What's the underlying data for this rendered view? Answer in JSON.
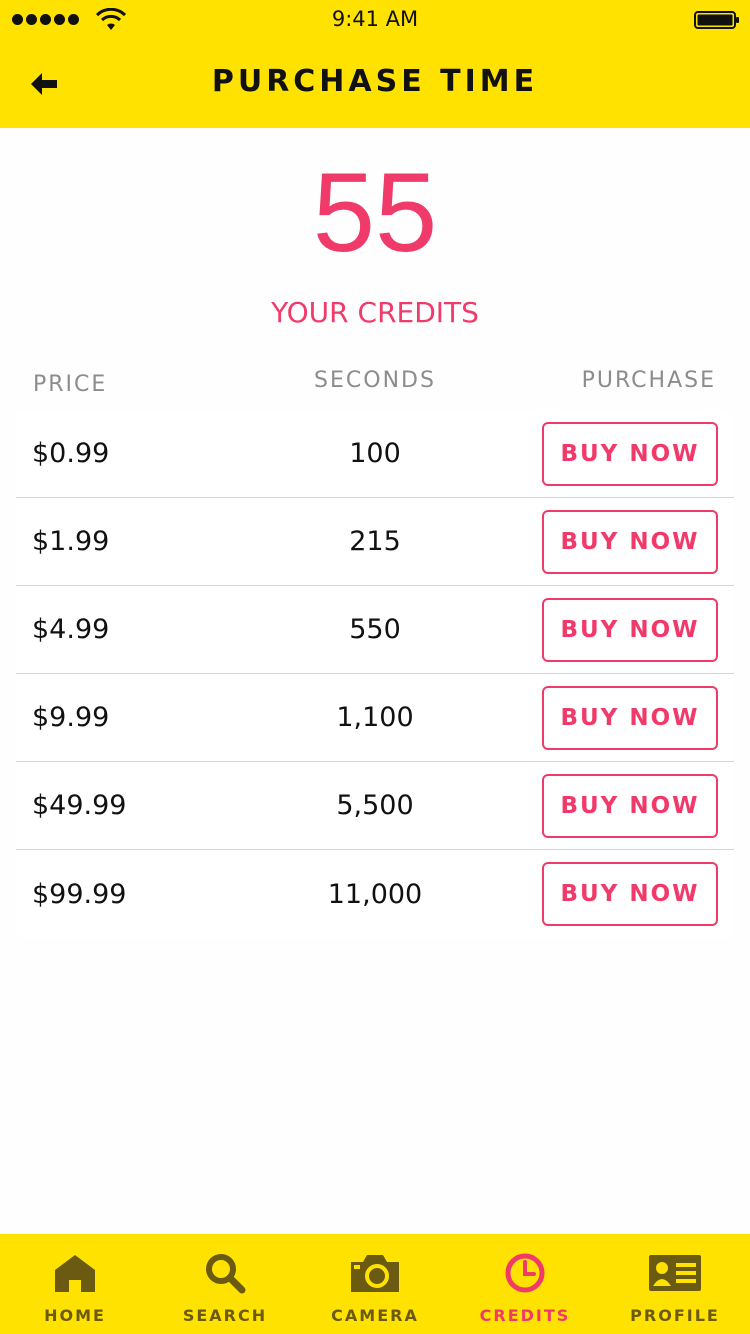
{
  "status_bar": {
    "time": "9:41 AM",
    "signal_icon": "signal-dots-icon",
    "wifi_icon": "wifi-icon",
    "battery_icon": "battery-icon"
  },
  "header": {
    "title": "PURCHASE TIME",
    "back_icon": "arrow-left-icon"
  },
  "credits": {
    "value": "55",
    "label": "YOUR CREDITS"
  },
  "table": {
    "columns": {
      "price": "PRICE",
      "seconds": "SECONDS",
      "purchase": "PURCHASE"
    },
    "rows": [
      {
        "price": "$0.99",
        "seconds": "100",
        "button": "BUY NOW"
      },
      {
        "price": "$1.99",
        "seconds": "215",
        "button": "BUY NOW"
      },
      {
        "price": "$4.99",
        "seconds": "550",
        "button": "BUY NOW"
      },
      {
        "price": "$9.99",
        "seconds": "1,100",
        "button": "BUY NOW"
      },
      {
        "price": "$49.99",
        "seconds": "5,500",
        "button": "BUY NOW"
      },
      {
        "price": "$99.99",
        "seconds": "11,000",
        "button": "BUY NOW"
      }
    ]
  },
  "tab_bar": {
    "tabs": [
      {
        "label": "HOME",
        "icon": "home-icon",
        "active": false
      },
      {
        "label": "SEARCH",
        "icon": "search-icon",
        "active": false
      },
      {
        "label": "CAMERA",
        "icon": "camera-icon",
        "active": false
      },
      {
        "label": "CREDITS",
        "icon": "clock-icon",
        "active": true
      },
      {
        "label": "PROFILE",
        "icon": "profile-card-icon",
        "active": false
      }
    ]
  },
  "colors": {
    "brand_yellow": "#ffe200",
    "accent_pink": "#f03a6a",
    "tab_inactive": "#6b5a12"
  }
}
